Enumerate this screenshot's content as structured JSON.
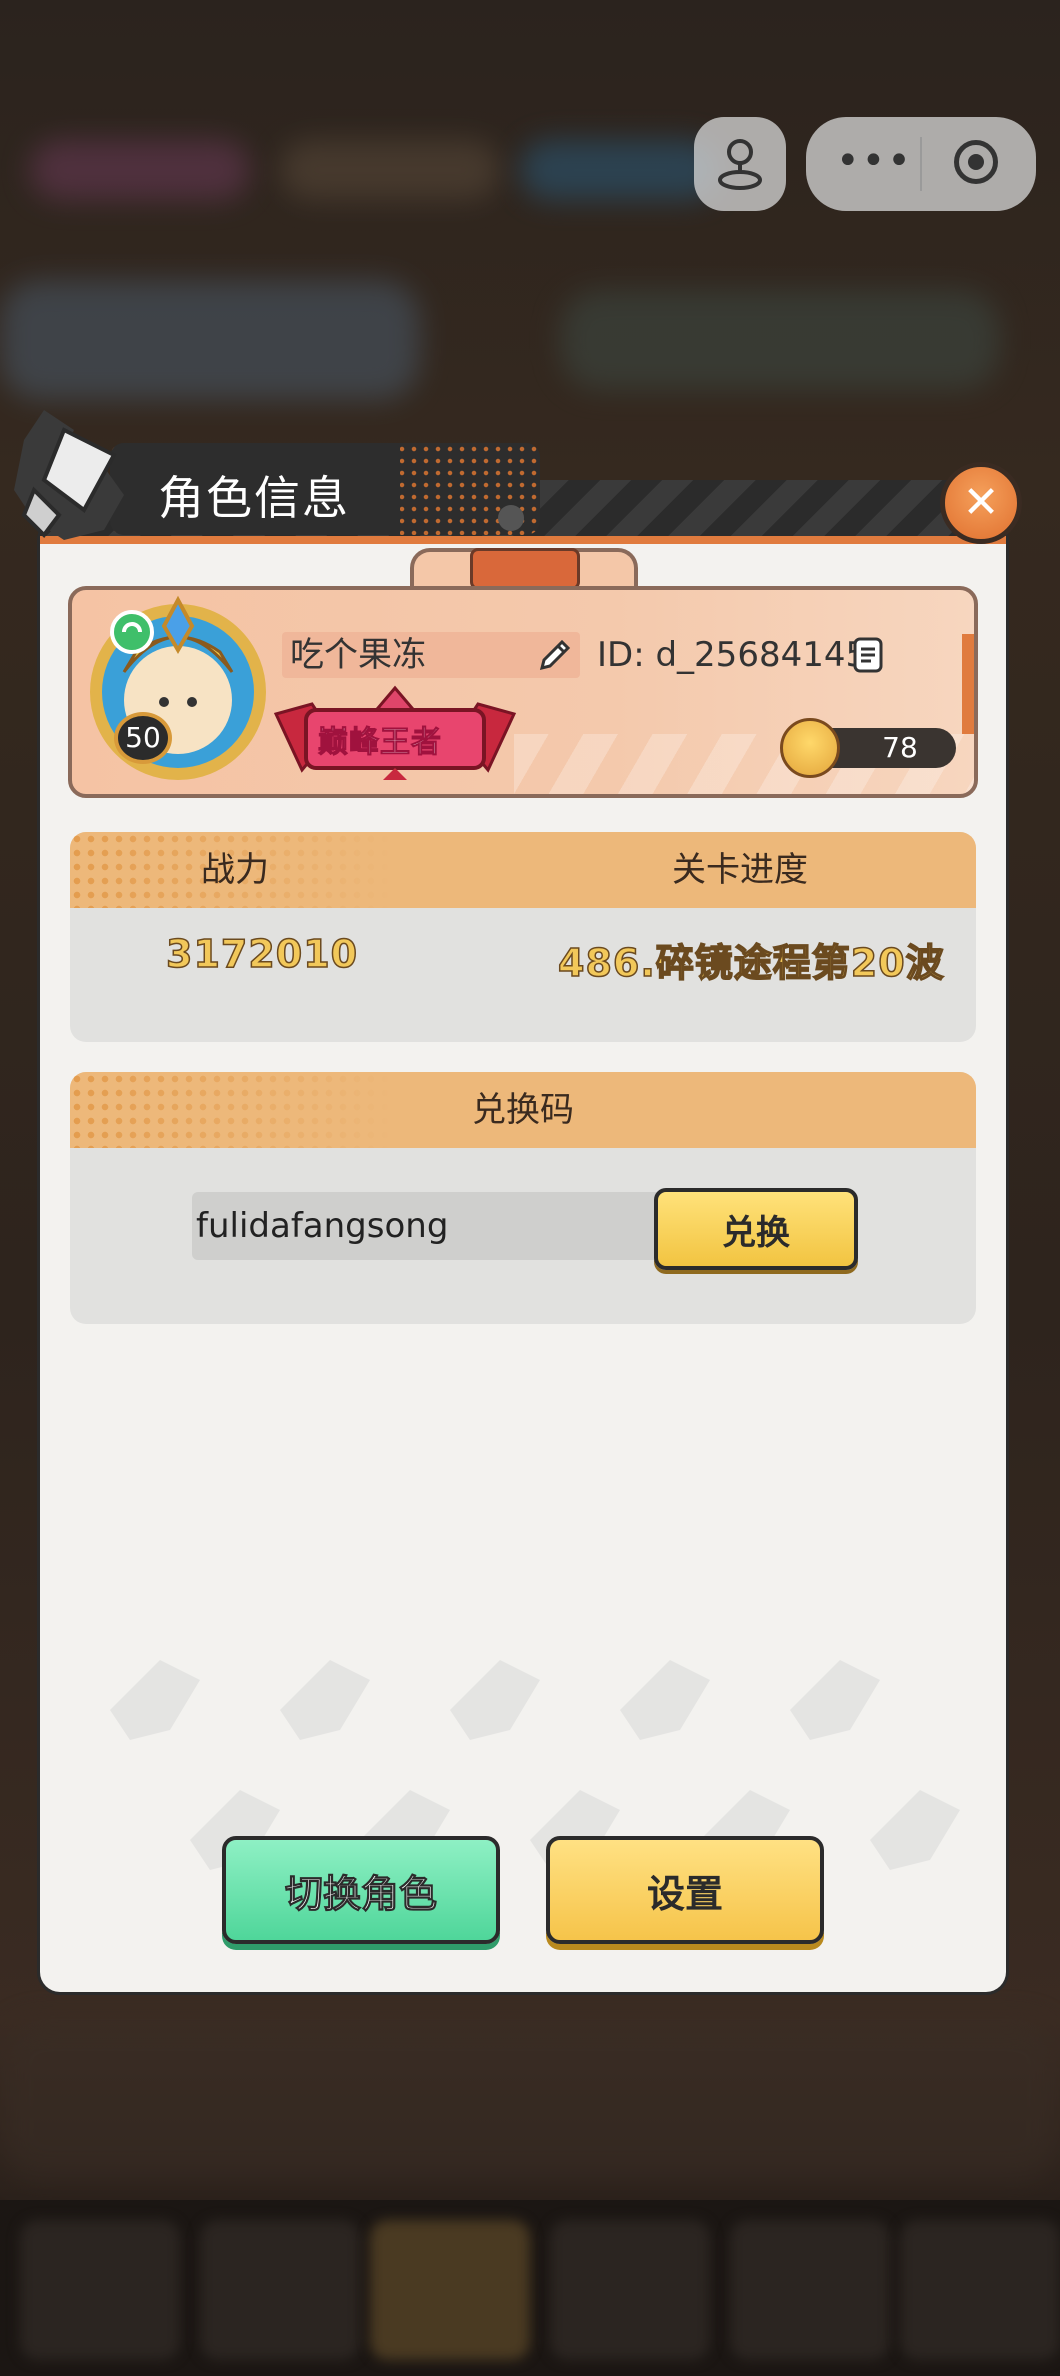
{
  "dialog": {
    "title": "角色信息",
    "close_icon": "close-icon"
  },
  "profile": {
    "name": "吃个果冻",
    "id": "ID: d_25684145",
    "level": "50",
    "rank_title": "巅峰王者",
    "likes": "78"
  },
  "stats": {
    "power_label": "战力",
    "progress_label": "关卡进度",
    "power_value": "3172010",
    "progress_value": "486.碎镜途程第20波"
  },
  "redeem": {
    "header": "兑换码",
    "code_value": "fulidafangsong",
    "button_label": "兑换"
  },
  "buttons": {
    "switch_role": "切换角色",
    "settings": "设置"
  },
  "colors": {
    "accent_orange": "#e07b3e",
    "panel_header": "#edb87a",
    "switch_green": "#4fd69a",
    "settings_yellow": "#f6c44a"
  }
}
